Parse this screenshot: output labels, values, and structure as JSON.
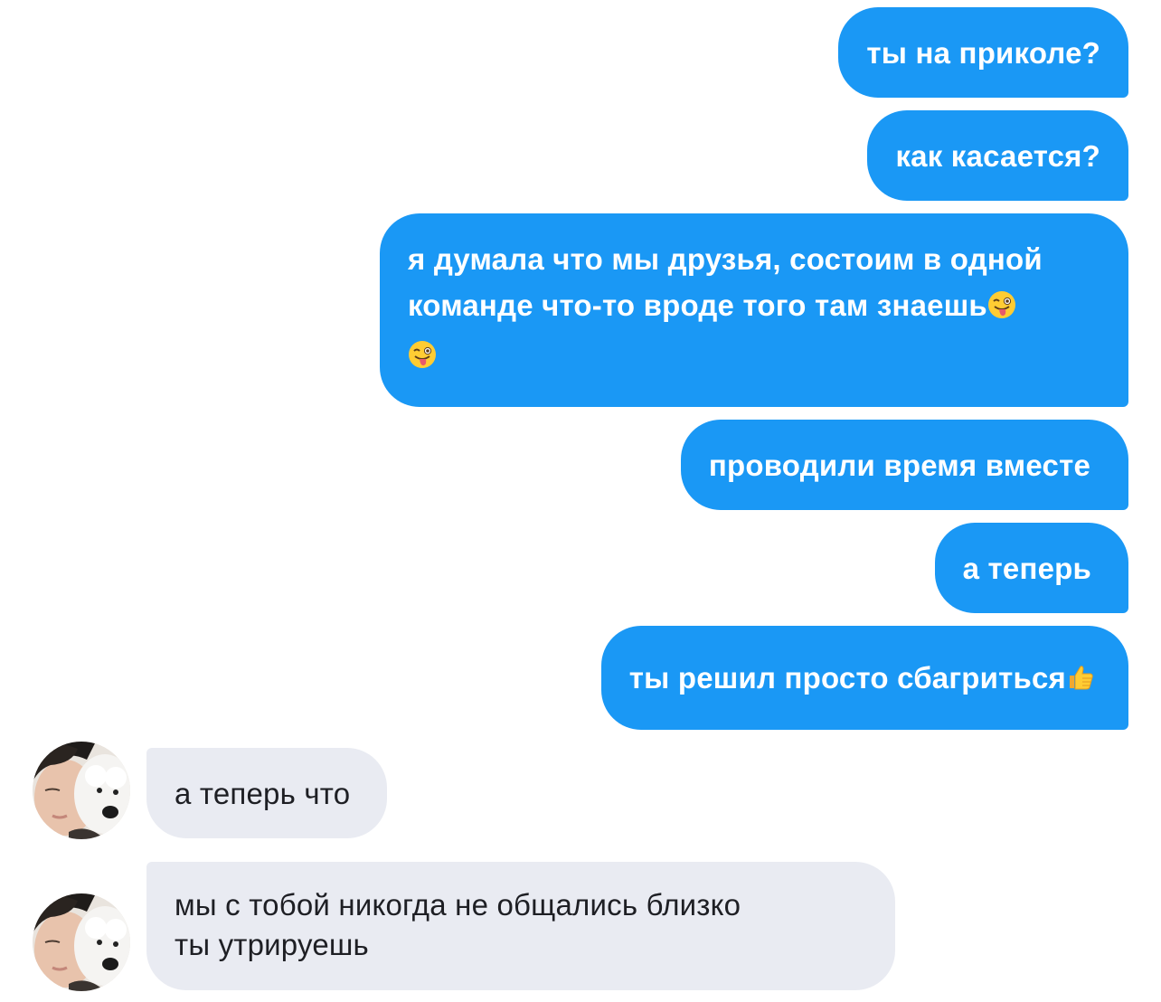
{
  "messages": {
    "outgoing": [
      {
        "text": "ты на приколе?"
      },
      {
        "text": "как касается?"
      },
      {
        "line1": "я думала что мы друзья, состоим в одной",
        "line2": "команде что-то вроде того там знаешь"
      },
      {
        "text": "проводили время вместе"
      },
      {
        "text": "а теперь"
      },
      {
        "text": "ты решил просто сбагриться"
      }
    ],
    "incoming": [
      {
        "text": "а теперь что"
      },
      {
        "line1": "мы с тобой никогда не общались близко",
        "line2": "ты утрируешь"
      }
    ]
  },
  "colors": {
    "outgoing_bubble": "#1a98f5",
    "incoming_bubble": "#e9ebf2",
    "incoming_text": "#1e1f24"
  },
  "icons": [
    "winking-tongue-emoji",
    "thumbs-up-emoji",
    "contact-avatar"
  ]
}
